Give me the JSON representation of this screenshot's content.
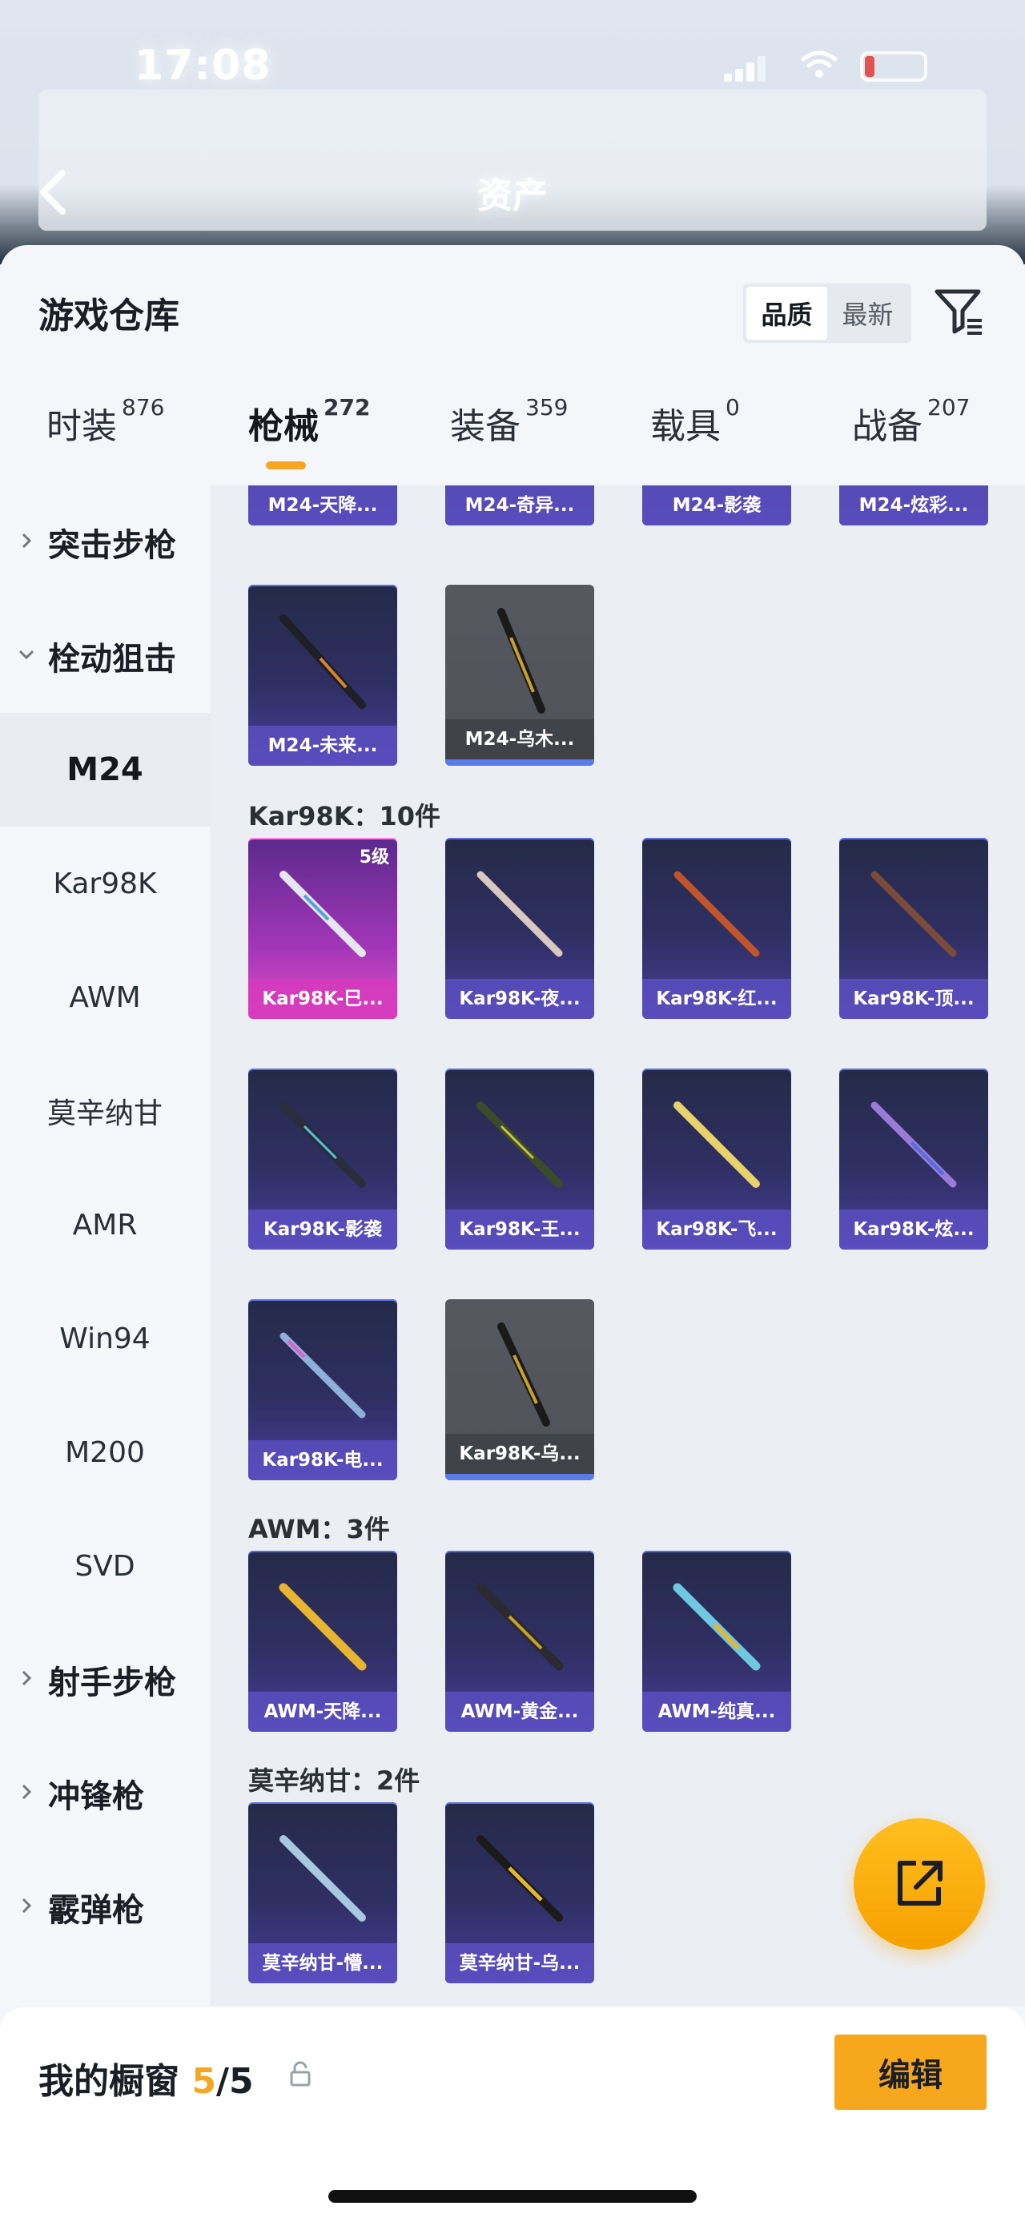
{
  "status_bar": {
    "time": "17:08"
  },
  "header": {
    "title": "资产"
  },
  "panel": {
    "title": "游戏仓库",
    "sort_options": [
      "品质",
      "最新"
    ],
    "selected_sort": "品质"
  },
  "tabs": [
    {
      "label": "时装",
      "count": "876"
    },
    {
      "label": "枪械",
      "count": "272"
    },
    {
      "label": "装备",
      "count": "359"
    },
    {
      "label": "载具",
      "count": "0"
    },
    {
      "label": "战备",
      "count": "207"
    }
  ],
  "sidebar": {
    "items": [
      {
        "label": "突击步枪"
      },
      {
        "label": "栓动狙击"
      },
      {
        "label": "M24"
      },
      {
        "label": "Kar98K"
      },
      {
        "label": "AWM"
      },
      {
        "label": "莫辛纳甘"
      },
      {
        "label": "AMR"
      },
      {
        "label": "Win94"
      },
      {
        "label": "M200"
      },
      {
        "label": "SVD"
      },
      {
        "label": "射手步枪"
      },
      {
        "label": "冲锋枪"
      },
      {
        "label": "霰弹枪"
      }
    ]
  },
  "sections": [
    {
      "label": "Kar98K：10件"
    },
    {
      "label": "AWM：3件"
    },
    {
      "label": "莫辛纳甘：2件"
    }
  ],
  "items": {
    "m24": [
      "M24-天降...",
      "M24-奇异...",
      "M24-影袭",
      "M24-炫彩...",
      "M24-未来...",
      "M24-乌木..."
    ],
    "kar98k": [
      "Kar98K-巳...",
      "Kar98K-夜...",
      "Kar98K-红...",
      "Kar98K-顶...",
      "Kar98K-影袭",
      "Kar98K-王...",
      "Kar98K-飞...",
      "Kar98K-炫...",
      "Kar98K-电...",
      "Kar98K-乌..."
    ],
    "kar98k_badge": "5级",
    "awm": [
      "AWM-天降...",
      "AWM-黄金...",
      "AWM-纯真..."
    ],
    "mosin": [
      "莫辛纳甘-懵...",
      "莫辛纳甘-乌..."
    ]
  },
  "showcase": {
    "title": "我的橱窗",
    "used": "5",
    "separator": "/",
    "total": "5",
    "edit_label": "编辑"
  },
  "colors": {
    "accent": "#f5a623",
    "card": "#2f2f63",
    "rare_card": "#e04fc4"
  }
}
